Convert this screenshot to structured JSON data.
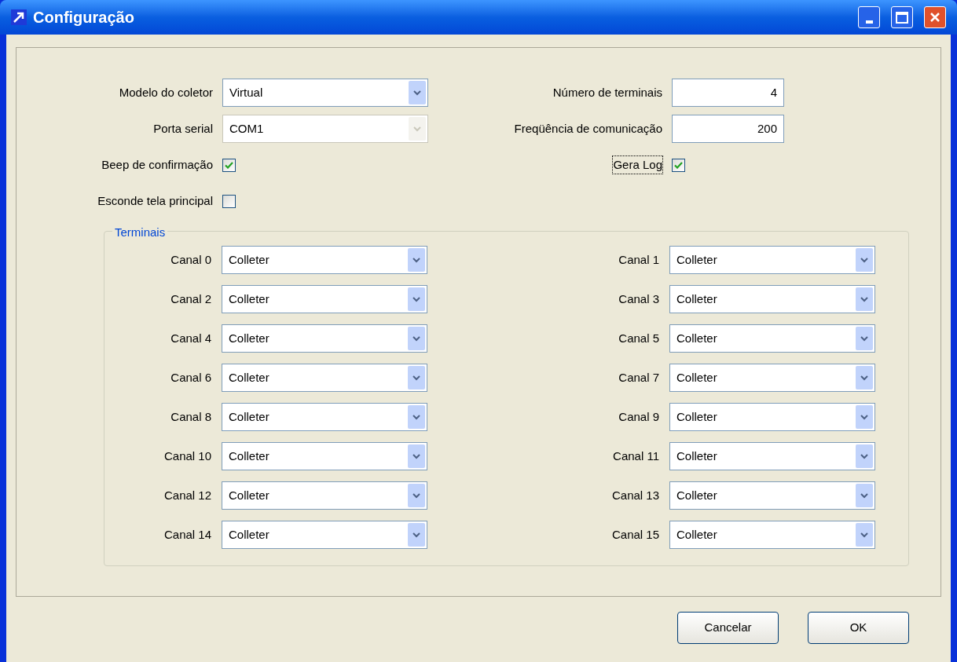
{
  "window": {
    "title": "Configuração"
  },
  "left_settings": [
    {
      "kind": "combo",
      "label": "Modelo do coletor",
      "value": "Virtual",
      "disabled": false
    },
    {
      "kind": "combo",
      "label": "Porta serial",
      "value": "COM1",
      "disabled": true
    },
    {
      "kind": "checkbox",
      "label": "Beep de confirmação",
      "checked": true,
      "focused": false
    },
    {
      "kind": "checkbox",
      "label": "Esconde tela principal",
      "checked": false,
      "focused": false
    }
  ],
  "right_settings": [
    {
      "kind": "number",
      "label": "Número de terminais",
      "value": "4"
    },
    {
      "kind": "number",
      "label": "Freqüência de comunicação",
      "value": "200"
    },
    {
      "kind": "checkbox",
      "label": "Gera Log",
      "checked": true,
      "focused": true
    }
  ],
  "terminals": {
    "title": "Terminais",
    "channels": [
      {
        "label": "Canal 0",
        "value": "Colleter"
      },
      {
        "label": "Canal 1",
        "value": "Colleter"
      },
      {
        "label": "Canal 2",
        "value": "Colleter"
      },
      {
        "label": "Canal 3",
        "value": "Colleter"
      },
      {
        "label": "Canal 4",
        "value": "Colleter"
      },
      {
        "label": "Canal 5",
        "value": "Colleter"
      },
      {
        "label": "Canal 6",
        "value": "Colleter"
      },
      {
        "label": "Canal 7",
        "value": "Colleter"
      },
      {
        "label": "Canal 8",
        "value": "Colleter"
      },
      {
        "label": "Canal 9",
        "value": "Colleter"
      },
      {
        "label": "Canal 10",
        "value": "Colleter"
      },
      {
        "label": "Canal 11",
        "value": "Colleter"
      },
      {
        "label": "Canal 12",
        "value": "Colleter"
      },
      {
        "label": "Canal 13",
        "value": "Colleter"
      },
      {
        "label": "Canal 14",
        "value": "Colleter"
      },
      {
        "label": "Canal 15",
        "value": "Colleter"
      }
    ]
  },
  "buttons": [
    {
      "label": "Cancelar"
    },
    {
      "label": "OK"
    }
  ]
}
